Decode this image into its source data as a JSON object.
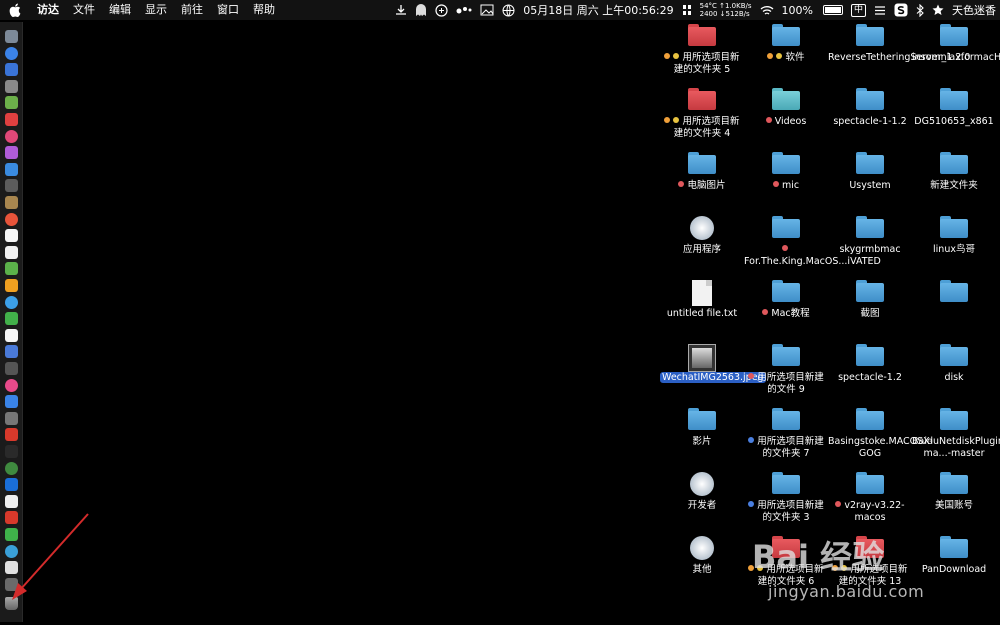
{
  "menubar": {
    "menus": [
      "访达",
      "文件",
      "编辑",
      "显示",
      "前往",
      "窗口",
      "帮助"
    ],
    "net_up": "54°C ↑1.0KB/s",
    "net_down": "2400 ↓512B/s",
    "datetime": "05月18日 周六 上午00:56:29",
    "battery": "100%",
    "input_method": "中",
    "user": "天色迷香"
  },
  "desktop": {
    "items": [
      {
        "label": "用所选项目新建的文件夹 5",
        "kind": "folder",
        "color": "red",
        "tags": [
          "orange",
          "yellow"
        ],
        "col": 0,
        "row": 0
      },
      {
        "label": "软件",
        "kind": "folder",
        "color": "blue",
        "tags": [
          "orange",
          "yellow"
        ],
        "col": 1,
        "row": 0
      },
      {
        "label": "ReverseTetheringServer_1.2.0",
        "kind": "folder",
        "color": "blue",
        "tags": [],
        "col": 2,
        "row": 0
      },
      {
        "label": "insomniaxformacHHB_jb51",
        "kind": "folder",
        "color": "blue",
        "tags": [],
        "col": 3,
        "row": 0
      },
      {
        "label": "用所选项目新建的文件夹 4",
        "kind": "folder",
        "color": "red",
        "tags": [
          "orange",
          "yellow"
        ],
        "col": 0,
        "row": 1
      },
      {
        "label": "Videos",
        "kind": "folder",
        "color": "teal",
        "tags": [
          "red"
        ],
        "col": 1,
        "row": 1
      },
      {
        "label": "spectacle-1-1.2",
        "kind": "folder",
        "color": "blue",
        "tags": [],
        "col": 2,
        "row": 1
      },
      {
        "label": "DG510653_x861",
        "kind": "folder",
        "color": "blue",
        "tags": [],
        "col": 3,
        "row": 1
      },
      {
        "label": "电脑图片",
        "kind": "folder",
        "color": "blue",
        "tags": [
          "red"
        ],
        "col": 0,
        "row": 2
      },
      {
        "label": "mic",
        "kind": "folder",
        "color": "blue",
        "tags": [
          "red"
        ],
        "col": 1,
        "row": 2
      },
      {
        "label": "Usystem",
        "kind": "folder",
        "color": "blue",
        "tags": [],
        "col": 2,
        "row": 2
      },
      {
        "label": "新建文件夹",
        "kind": "folder",
        "color": "blue",
        "tags": [],
        "col": 3,
        "row": 2
      },
      {
        "label": "应用程序",
        "kind": "app",
        "color": "blue",
        "tags": [],
        "col": 0,
        "row": 3
      },
      {
        "label": "For.The.King.MacOS...iVATED",
        "kind": "folder",
        "color": "blue",
        "tags": [
          "red"
        ],
        "col": 1,
        "row": 3
      },
      {
        "label": "skygrmbmac",
        "kind": "folder",
        "color": "blue",
        "tags": [],
        "col": 2,
        "row": 3
      },
      {
        "label": "linux鸟哥",
        "kind": "folder",
        "color": "blue",
        "tags": [],
        "col": 3,
        "row": 3
      },
      {
        "label": "untitled file.txt",
        "kind": "doc",
        "color": "blue",
        "tags": [],
        "col": 0,
        "row": 4
      },
      {
        "label": "Mac教程",
        "kind": "folder",
        "color": "blue",
        "tags": [
          "red"
        ],
        "col": 1,
        "row": 4
      },
      {
        "label": "截图",
        "kind": "folder",
        "color": "blue",
        "tags": [],
        "col": 2,
        "row": 4
      },
      {
        "label": "",
        "kind": "folder",
        "color": "blue",
        "tags": [],
        "col": 3,
        "row": 4
      },
      {
        "label": "WechatIMG2563.jpeg",
        "kind": "photo",
        "color": "blue",
        "tags": [],
        "col": 0,
        "row": 5,
        "selected": true
      },
      {
        "label": "用所选项目新建的文件 9",
        "kind": "folder",
        "color": "blue",
        "tags": [
          "red"
        ],
        "col": 1,
        "row": 5
      },
      {
        "label": "spectacle-1.2",
        "kind": "folder",
        "color": "blue",
        "tags": [],
        "col": 2,
        "row": 5
      },
      {
        "label": "disk",
        "kind": "folder",
        "color": "blue",
        "tags": [],
        "col": 3,
        "row": 5
      },
      {
        "label": "影片",
        "kind": "folder",
        "color": "blue",
        "tags": [],
        "col": 0,
        "row": 6
      },
      {
        "label": "用所选项目新建的文件夹 7",
        "kind": "folder",
        "color": "blue",
        "tags": [
          "blue"
        ],
        "col": 1,
        "row": 6
      },
      {
        "label": "Basingstoke.MACOSX-GOG",
        "kind": "folder",
        "color": "blue",
        "tags": [],
        "col": 2,
        "row": 6
      },
      {
        "label": "BaiduNetdiskPlugin-ma...-master",
        "kind": "folder",
        "color": "blue",
        "tags": [],
        "col": 3,
        "row": 6
      },
      {
        "label": "开发者",
        "kind": "app",
        "color": "blue",
        "tags": [],
        "col": 0,
        "row": 7
      },
      {
        "label": "用所选项目新建的文件夹 3",
        "kind": "folder",
        "color": "blue",
        "tags": [
          "blue"
        ],
        "col": 1,
        "row": 7
      },
      {
        "label": "v2ray-v3.22-macos",
        "kind": "folder",
        "color": "blue",
        "tags": [
          "red"
        ],
        "col": 2,
        "row": 7
      },
      {
        "label": "美国账号",
        "kind": "folder",
        "color": "blue",
        "tags": [],
        "col": 3,
        "row": 7
      },
      {
        "label": "其他",
        "kind": "app",
        "color": "blue",
        "tags": [],
        "col": 0,
        "row": 8
      },
      {
        "label": "用所选项目新建的文件夹 6",
        "kind": "folder",
        "color": "red",
        "tags": [
          "orange",
          "yellow"
        ],
        "col": 1,
        "row": 8
      },
      {
        "label": "用所选项目新建的文件夹 13",
        "kind": "folder",
        "color": "red",
        "tags": [
          "orange",
          "yellow"
        ],
        "col": 2,
        "row": 8
      },
      {
        "label": "PanDownload",
        "kind": "folder",
        "color": "blue",
        "tags": [],
        "col": 3,
        "row": 8
      }
    ]
  },
  "dock": {
    "colors": [
      "#7d8a99",
      "#3b83e8",
      "#3a74d8",
      "#8a8a8a",
      "#6cb04a",
      "#e04040",
      "#e04878",
      "#b05cd8",
      "#3a8be0",
      "#5c5c5c",
      "#a8864f",
      "#e8543a",
      "#f5f5f5",
      "#f0f0f0",
      "#5bb14a",
      "#f0a020",
      "#3ca0e8",
      "#42b04a",
      "#f5f5f5",
      "#4a7ad8",
      "#555",
      "#e84a8a",
      "#3a84e8",
      "#777",
      "#d8392b",
      "#2a2a2a",
      "#3f8a3f",
      "#1a6ed8",
      "#f0f0f0",
      "#d8392b",
      "#3fb24a",
      "#3aa0d8",
      "#e0e0e0",
      "#6a6a6a"
    ]
  },
  "watermark": {
    "logo": "Bai 经验",
    "url": "jingyan.baidu.com"
  }
}
